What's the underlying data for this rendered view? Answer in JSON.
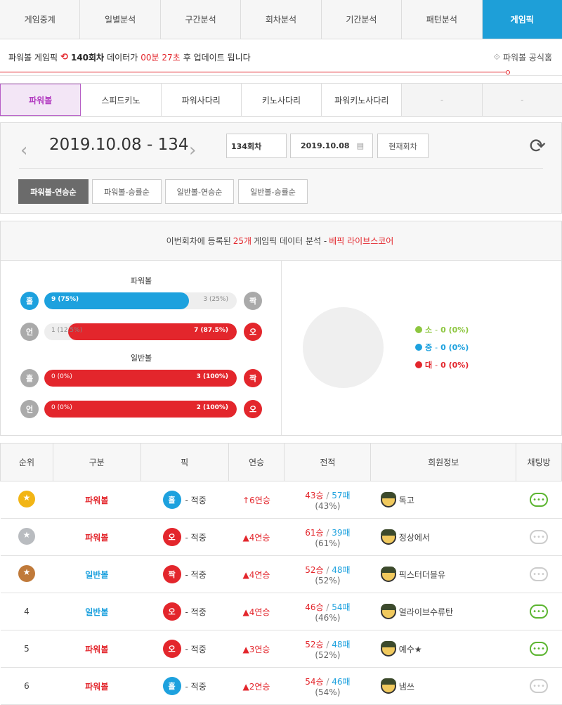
{
  "top_tabs": [
    "게임중계",
    "일별분석",
    "구간분석",
    "회차분석",
    "기간분석",
    "패턴분석",
    "게임픽"
  ],
  "notice": {
    "prefix": "파워볼 게임픽",
    "round": "140회차",
    "mid": "데이터가",
    "time": "00분 27초",
    "suffix": "후 업데이트 됩니다",
    "home": "파워볼 공식홈"
  },
  "sub_tabs": [
    "파워볼",
    "스피드키노",
    "파워사다리",
    "키노사다리",
    "파워키노사다리",
    "-",
    "-"
  ],
  "round_panel": {
    "date_round": "2019.10.08 - 134",
    "round_field": "134회차",
    "date_field": "2019.10.08",
    "current_btn": "현재회차",
    "sort_buttons": [
      "파워볼-연승순",
      "파워볼-승률순",
      "일반볼-연승순",
      "일반볼-승률순"
    ]
  },
  "analysis": {
    "head_prefix": "이번회차에 등록된",
    "count": "25개",
    "head_mid": "게임픽 데이터 분석 -",
    "brand": "베픽 라이브스코어",
    "powerball_title": "파워볼",
    "normalball_title": "일반볼",
    "bars": [
      {
        "left_ball": "홀",
        "right_ball": "짝",
        "left_label": "9 (75%)",
        "right_label": "3 (25%)",
        "left_fraction": 0.75,
        "color": "blue"
      },
      {
        "left_ball": "언",
        "right_ball": "오",
        "left_label": "1 (12.5%)",
        "right_label": "7 (87.5%)",
        "right_fraction": 0.875,
        "color": "red"
      },
      {
        "left_ball": "홀",
        "right_ball": "짝",
        "left_label": "0 (0%)",
        "right_label": "3 (100%)",
        "right_fraction": 1.0,
        "color": "red"
      },
      {
        "left_ball": "언",
        "right_ball": "오",
        "left_label": "0 (0%)",
        "right_label": "2 (100%)",
        "right_fraction": 1.0,
        "color": "red"
      }
    ],
    "legend": [
      {
        "name": "소",
        "value": "0 (0%)",
        "color": "#8dc63f"
      },
      {
        "name": "중",
        "value": "0 (0%)",
        "color": "#1da1de"
      },
      {
        "name": "대",
        "value": "0 (0%)",
        "color": "#e3262c"
      }
    ]
  },
  "table": {
    "headers": [
      "순위",
      "구분",
      "픽",
      "연승",
      "전적",
      "회원정보",
      "채팅방"
    ],
    "rows": [
      {
        "rank": "",
        "medal": "#f2b515",
        "type": "파워볼",
        "type_class": "pw",
        "pick": "홀",
        "pick_color": "blue",
        "pick_text": "- 적중",
        "streak": "↑6연승",
        "win": "43승",
        "loss": "57패",
        "pct": "(43%)",
        "member": "독고",
        "chat_on": true
      },
      {
        "rank": "",
        "medal": "#b9bcc0",
        "type": "파워볼",
        "type_class": "pw",
        "pick": "오",
        "pick_color": "red",
        "pick_text": "- 적중",
        "streak": "▲4연승",
        "win": "61승",
        "loss": "39패",
        "pct": "(61%)",
        "member": "정상에서",
        "chat_on": false
      },
      {
        "rank": "",
        "medal": "#c07a3a",
        "type": "일반볼",
        "type_class": "nb",
        "pick": "짝",
        "pick_color": "red",
        "pick_text": "- 적중",
        "streak": "▲4연승",
        "win": "52승",
        "loss": "48패",
        "pct": "(52%)",
        "member": "픽스터더블유",
        "chat_on": false
      },
      {
        "rank": "4",
        "medal": "",
        "type": "일반볼",
        "type_class": "nb",
        "pick": "오",
        "pick_color": "red",
        "pick_text": "- 적중",
        "streak": "▲4연승",
        "win": "46승",
        "loss": "54패",
        "pct": "(46%)",
        "member": "얼라이브수류탄",
        "chat_on": true
      },
      {
        "rank": "5",
        "medal": "",
        "type": "파워볼",
        "type_class": "pw",
        "pick": "오",
        "pick_color": "red",
        "pick_text": "- 적중",
        "streak": "▲3연승",
        "win": "52승",
        "loss": "48패",
        "pct": "(52%)",
        "member": "예수★",
        "chat_on": true
      },
      {
        "rank": "6",
        "medal": "",
        "type": "파워볼",
        "type_class": "pw",
        "pick": "홀",
        "pick_color": "blue",
        "pick_text": "- 적중",
        "streak": "▲2연승",
        "win": "54승",
        "loss": "46패",
        "pct": "(54%)",
        "member": "냄쓰",
        "chat_on": false
      }
    ]
  }
}
